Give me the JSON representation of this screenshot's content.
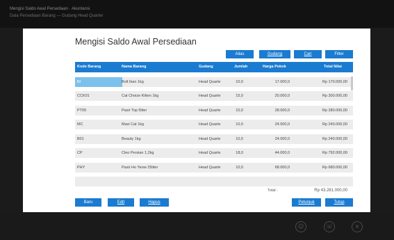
{
  "window": {
    "title_line1": "Mengisi Saldo Awal Persediaan · Akuntansi",
    "title_line2": "Data Persediaan Barang — Gudang Head Quarter"
  },
  "page_title": "Mengisi Saldo Awal Persediaan",
  "toolbar": {
    "alias": "Alias",
    "gudang": "Gudang",
    "cari": "Cari",
    "filter": "Filter"
  },
  "table": {
    "columns": [
      "Kode Barang",
      "Nama Barang",
      "Gudang",
      "Jumlah",
      "Harga Pokok",
      "Total Nilai"
    ],
    "rows": [
      {
        "kode": "BI",
        "nama": "Bolt Ikan 1kg",
        "gudang": "Head Quarte",
        "jumlah": "10,0",
        "harga": "17.000,0",
        "total": "Rp 170.000,00"
      },
      {
        "kode": "CCK01",
        "nama": "Cat Choize Kitten 1kg",
        "gudang": "Head Quarte",
        "jumlah": "15,0",
        "harga": "20.000,0",
        "total": "Rp 300.000,00"
      },
      {
        "kode": "PT05",
        "nama": "Pasir Top 5liter",
        "gudang": "Head Quarte",
        "jumlah": "10,0",
        "harga": "28.000,0",
        "total": "Rp 280.000,00"
      },
      {
        "kode": "MC",
        "nama": "Maxi Cat 1kg",
        "gudang": "Head Quarte",
        "jumlah": "10,0",
        "harga": "24.000,0",
        "total": "Rp 240.000,00"
      },
      {
        "kode": "B01",
        "nama": "Beauty 1kg",
        "gudang": "Head Quarte",
        "jumlah": "10,0",
        "harga": "24.000,0",
        "total": "Rp 240.000,00"
      },
      {
        "kode": "CP",
        "nama": "Cleo Persian 1,2kg",
        "gudang": "Head Quarte",
        "jumlah": "18,0",
        "harga": "44.000,0",
        "total": "Rp 792.000,00"
      },
      {
        "kode": "PHY",
        "nama": "Pasir Ho Yeow 25liter",
        "gudang": "Head Quarte",
        "jumlah": "10,0",
        "harga": "68.000,0",
        "total": "Rp 680.000,00"
      }
    ]
  },
  "total": {
    "label": "Total :",
    "value": "Rp 43.281.000,00"
  },
  "footer": {
    "baru": "Baru",
    "edit": "Edit",
    "hapus": "Hapus",
    "petunjuk": "Petunjuk",
    "tutup": "Tutup"
  },
  "colors": {
    "accent": "#1a7bd0",
    "selected_cell": "#7bc1ec",
    "row_bg": "#ececec",
    "frame_bg": "#1b1b1b"
  },
  "icons": [
    "user-icon",
    "phone-icon",
    "close-circle-icon"
  ]
}
